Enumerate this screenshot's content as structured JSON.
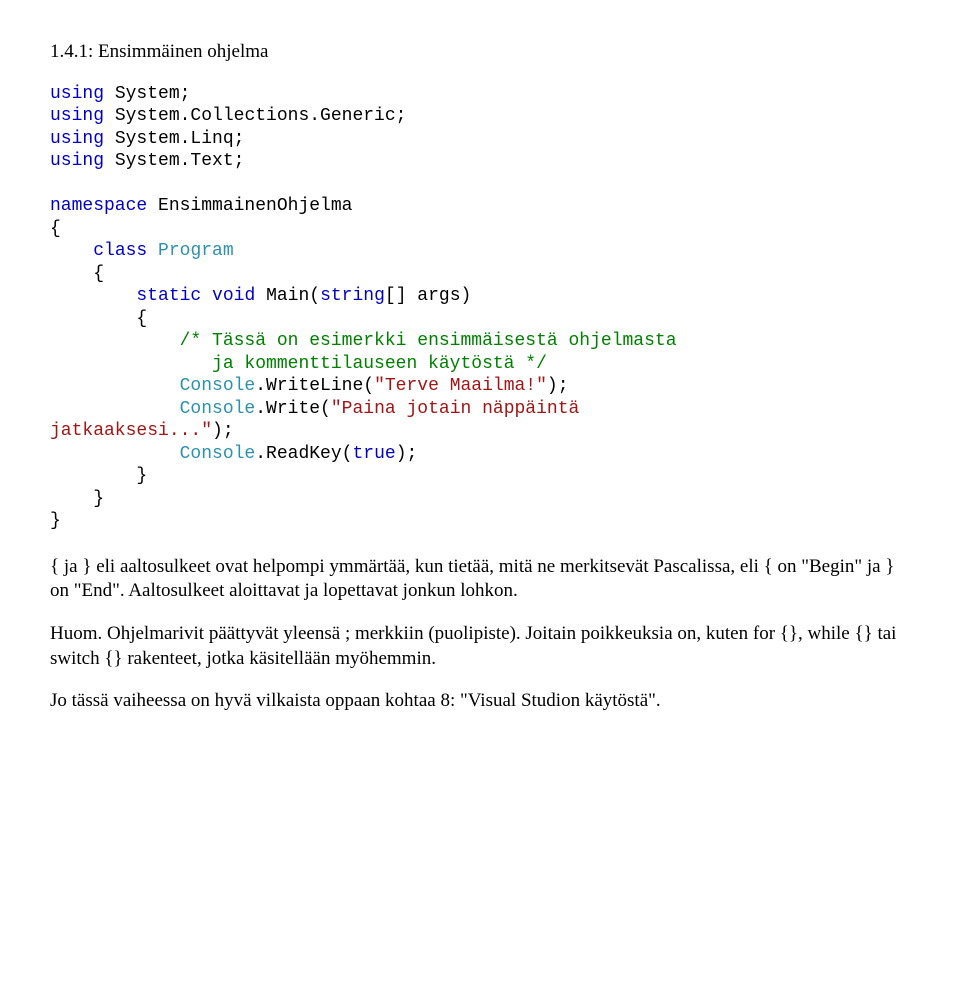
{
  "title": "1.4.1: Ensimmäinen ohjelma",
  "code": {
    "l1a": "using",
    "l1b": " System;",
    "l2a": "using",
    "l2b": " System.Collections.Generic;",
    "l3a": "using",
    "l3b": " System.Linq;",
    "l4a": "using",
    "l4b": " System.Text;",
    "l6a": "namespace",
    "l6b": " EnsimmainenOhjelma",
    "l7": "{",
    "l8a": "    ",
    "l8b": "class",
    "l8c": " ",
    "l8d": "Program",
    "l9": "    {",
    "l10a": "        ",
    "l10b": "static",
    "l10c": " ",
    "l10d": "void",
    "l10e": " Main(",
    "l10f": "string",
    "l10g": "[] args)",
    "l11": "        {",
    "l12a": "            ",
    "l12b": "/* Tässä on esimerkki ensimmäisestä ohjelmasta",
    "l13": "               ja kommenttilauseen käytöstä */",
    "l14a": "            ",
    "l14b": "Console",
    "l14c": ".WriteLine(",
    "l14d": "\"Terve Maailma!\"",
    "l14e": ");",
    "l15a": "            ",
    "l15b": "Console",
    "l15c": ".Write(",
    "l15d": "\"Paina jotain näppäintä ",
    "l16a": "jatkaaksesi...\"",
    "l16b": ");",
    "l17a": "            ",
    "l17b": "Console",
    "l17c": ".ReadKey(",
    "l17d": "true",
    "l17e": ");",
    "l18": "        }",
    "l19": "    }",
    "l20": "}"
  },
  "para1": "{ ja } eli aaltosulkeet ovat helpompi ymmärtää, kun tietää, mitä ne merkitsevät Pascalissa, eli { on \"Begin\" ja } on \"End\". Aaltosulkeet aloittavat ja lopettavat jonkun lohkon.",
  "para2": "Huom. Ohjelmarivit päättyvät yleensä ; merkkiin (puolipiste). Joitain poikkeuksia on, kuten for {}, while {} tai switch {} rakenteet, jotka käsitellään myöhemmin.",
  "para3": "Jo tässä vaiheessa on hyvä vilkaista oppaan kohtaa 8: \"Visual Studion käytöstä\"."
}
